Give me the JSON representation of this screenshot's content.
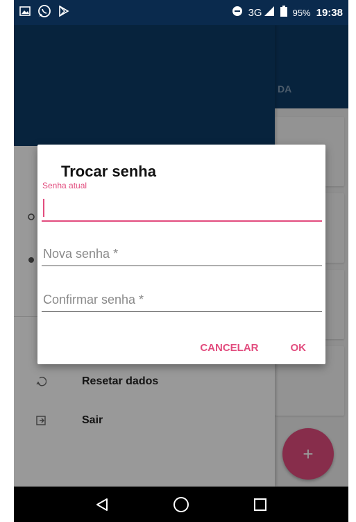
{
  "status_bar": {
    "network": "3G",
    "battery_percent": "95%",
    "time": "19:38"
  },
  "dialog": {
    "title": "Trocar senha",
    "current_password_label": "Senha atual",
    "new_password_placeholder": "Nova senha *",
    "confirm_password_placeholder": "Confirmar senha *",
    "cancel_label": "CANCELAR",
    "ok_label": "OK"
  },
  "drawer": {
    "items": [
      {
        "label": "Resetar dados",
        "icon": "reset-icon"
      },
      {
        "label": "Sair",
        "icon": "logout-icon"
      }
    ]
  },
  "background": {
    "tab_partial": "DA",
    "fab_icon": "+"
  },
  "colors": {
    "primary": "#0d3b66",
    "accent": "#e24c7e"
  }
}
